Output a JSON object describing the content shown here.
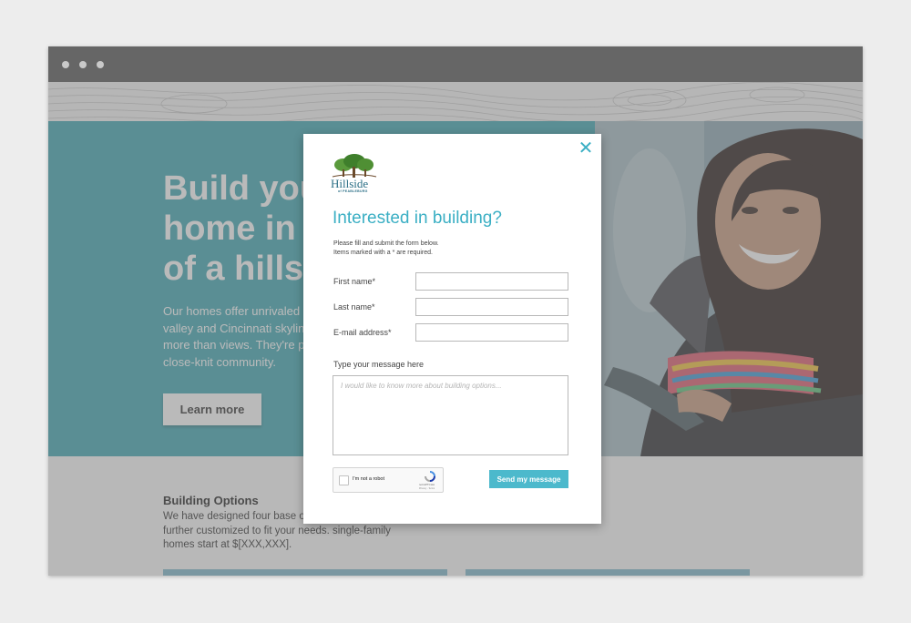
{
  "site": {
    "hero": {
      "title": "Build your\nhome in the\nof a hillside",
      "text": "Our homes offer unrivaled\nvalley and Cincinnati skyline\nmore than views. They're part\nclose-knit community.",
      "learn_more_label": "Learn more"
    },
    "building_options": {
      "title": "Building Options",
      "text": "We have designed four base options\nfurther customized to fit your needs. single-family\nhomes start at $[XXX,XXX]."
    }
  },
  "modal": {
    "close_symbol": "✕",
    "logo": {
      "word": "Hillside",
      "sub": "of PEABLEBURG"
    },
    "title": "Interested in building?",
    "instructions": "Please fill and submit the form below.\nItems marked with a * are required.",
    "fields": {
      "first_name": {
        "label": "First name*",
        "value": ""
      },
      "last_name": {
        "label": "Last name*",
        "value": ""
      },
      "email": {
        "label": "E-mail address*",
        "value": ""
      }
    },
    "message": {
      "label": "Type your message here",
      "placeholder": "I would like to know more about building options..."
    },
    "recaptcha": {
      "label": "I'm not a robot",
      "brand": "reCAPTCHA",
      "links": "Privacy - Terms"
    },
    "send_label": "Send my message"
  },
  "colors": {
    "accent": "#3bafc4",
    "hero_teal": "#3fa7b3",
    "titlebar": "#666666"
  }
}
